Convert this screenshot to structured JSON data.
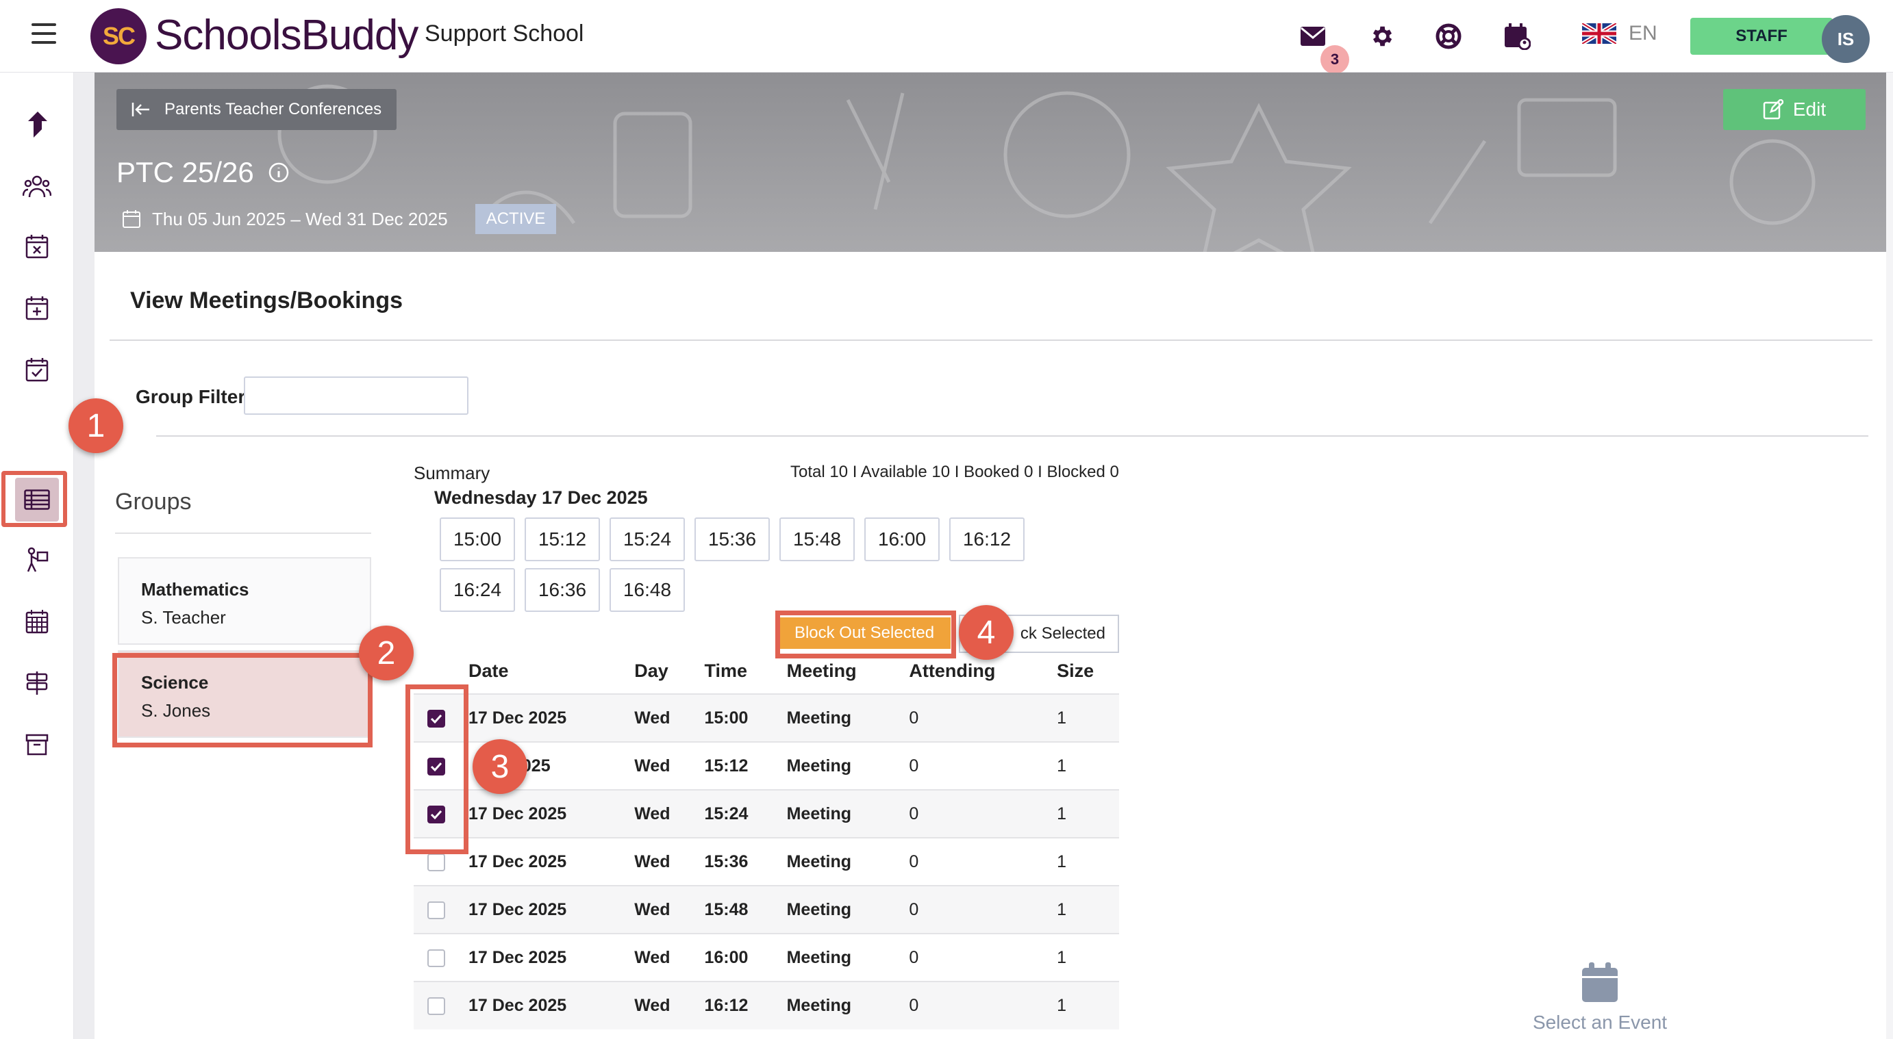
{
  "app": {
    "brand": "SchoolsBuddy",
    "logo_initials": "SC",
    "school_name": "Support School",
    "messages_badge": "3",
    "language": "EN",
    "role_button": "STAFF",
    "user_initials": "IS"
  },
  "sidebar": {
    "icons": [
      "share-arrow-icon",
      "people-icon",
      "calendar-x-icon",
      "calendar-plus-icon",
      "calendar-check-icon",
      "table-icon",
      "person-sign-icon",
      "calendar-grid-icon",
      "signpost-icon",
      "archive-icon"
    ],
    "active_index": 5
  },
  "banner": {
    "back_label": "Parents Teacher Conferences",
    "edit_label": "Edit",
    "title": "PTC 25/26",
    "date_range": "Thu 05 Jun 2025 – Wed 31 Dec 2025",
    "status": "ACTIVE"
  },
  "main": {
    "section_title": "View Meetings/Bookings",
    "group_filter_label": "Group Filter",
    "group_filter_value": "",
    "groups_title": "Groups",
    "groups": [
      {
        "name": "Mathematics",
        "teacher": "S. Teacher",
        "selected": false
      },
      {
        "name": "Science",
        "teacher": "S. Jones",
        "selected": true
      }
    ],
    "summary_label": "Summary",
    "summary_stats": "Total 10 I Available 10 I Booked 0 I Blocked 0",
    "day_label": "Wednesday 17 Dec 2025",
    "slots": [
      "15:00",
      "15:12",
      "15:24",
      "15:36",
      "15:48",
      "16:00",
      "16:12",
      "16:24",
      "16:36",
      "16:48"
    ],
    "block_out_label": "Block Out Selected",
    "unblock_label": "ck Selected",
    "table": {
      "headers": [
        "Date",
        "Day",
        "Time",
        "Meeting",
        "Attending",
        "Size"
      ],
      "rows": [
        {
          "checked": true,
          "date": "17 Dec 2025",
          "day": "Wed",
          "time": "15:00",
          "meeting": "Meeting",
          "attending": "0",
          "size": "1"
        },
        {
          "checked": true,
          "date": "2025",
          "day": "Wed",
          "time": "15:12",
          "meeting": "Meeting",
          "attending": "0",
          "size": "1"
        },
        {
          "checked": true,
          "date": "17 Dec 2025",
          "day": "Wed",
          "time": "15:24",
          "meeting": "Meeting",
          "attending": "0",
          "size": "1"
        },
        {
          "checked": false,
          "date": "17 Dec 2025",
          "day": "Wed",
          "time": "15:36",
          "meeting": "Meeting",
          "attending": "0",
          "size": "1"
        },
        {
          "checked": false,
          "date": "17 Dec 2025",
          "day": "Wed",
          "time": "15:48",
          "meeting": "Meeting",
          "attending": "0",
          "size": "1"
        },
        {
          "checked": false,
          "date": "17 Dec 2025",
          "day": "Wed",
          "time": "16:00",
          "meeting": "Meeting",
          "attending": "0",
          "size": "1"
        },
        {
          "checked": false,
          "date": "17 Dec 2025",
          "day": "Wed",
          "time": "16:12",
          "meeting": "Meeting",
          "attending": "0",
          "size": "1"
        }
      ]
    },
    "select_event_label": "Select an Event"
  },
  "callouts": [
    "1",
    "2",
    "3",
    "4"
  ],
  "colors": {
    "brand": "#4a1450",
    "accent_orange": "#f0a33a",
    "staff_green": "#6cd48a",
    "highlight_red": "#e06252"
  }
}
